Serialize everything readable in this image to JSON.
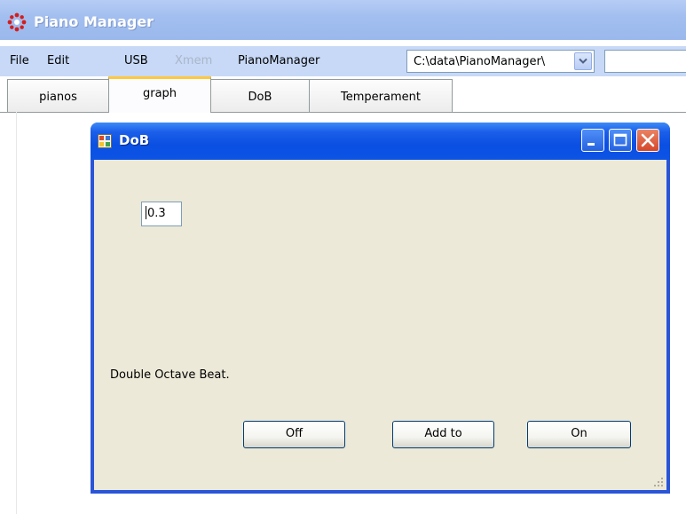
{
  "app": {
    "title": "Piano Manager"
  },
  "menu": {
    "file": "File",
    "edit": "Edit",
    "usb": "USB",
    "xmem": "Xmem",
    "piano_manager": "PianoManager",
    "path_value": "C:\\data\\PianoManager\\",
    "search_value": ""
  },
  "tabs": [
    {
      "label": "pianos",
      "active": false
    },
    {
      "label": "graph",
      "active": true
    },
    {
      "label": "DoB",
      "active": false
    },
    {
      "label": "Temperament",
      "active": false
    }
  ],
  "dialog": {
    "title": "DoB",
    "input_value": "0.3",
    "description": "Double Octave Beat.",
    "buttons": {
      "off": "Off",
      "add_to": "Add to",
      "on": "On"
    }
  },
  "colors": {
    "title_gradient": "#a3bff0",
    "dialog_titlebar": "#0a4fe2",
    "dialog_client": "#ece9d8",
    "close_button": "#d5472a",
    "active_tab_accent": "#ffc83c"
  },
  "icons": [
    "app-logo-icon",
    "window-icon",
    "minimize-icon",
    "maximize-icon",
    "close-icon",
    "chevron-down-icon",
    "resize-grip-icon"
  ]
}
